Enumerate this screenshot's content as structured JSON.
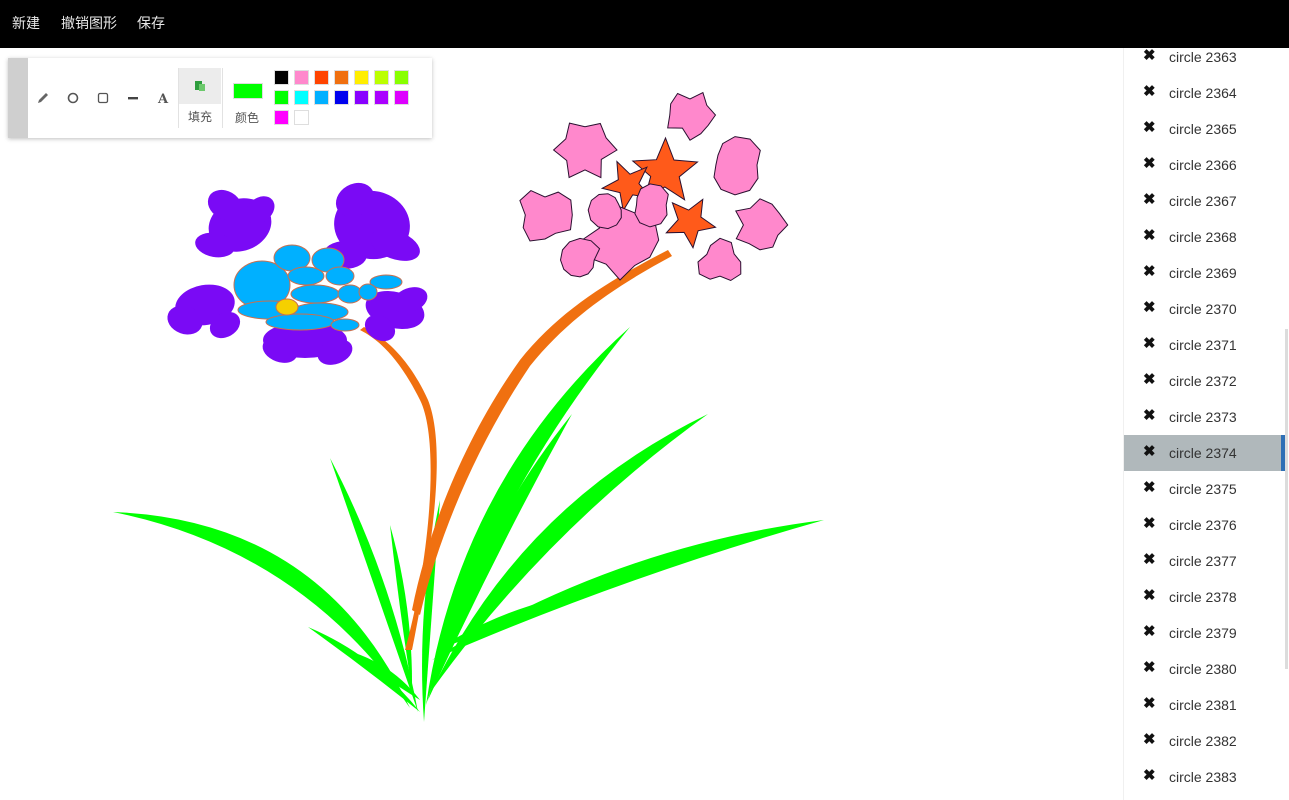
{
  "menu": {
    "new": "新建",
    "undo": "撤销图形",
    "save": "保存"
  },
  "toolbar": {
    "tools": [
      {
        "name": "pencil-tool",
        "icon": "pencil-icon"
      },
      {
        "name": "circle-tool",
        "icon": "circle-icon"
      },
      {
        "name": "rect-tool",
        "icon": "square-icon"
      },
      {
        "name": "line-tool",
        "icon": "line-icon"
      },
      {
        "name": "text-tool",
        "icon": "text-a-icon"
      }
    ],
    "fill_label": "填充",
    "color_label": "颜色",
    "current_color": "#00ff00",
    "palette": [
      "#000000",
      "#ff88cc",
      "#ff4400",
      "#f07010",
      "#ffee00",
      "#bbff00",
      "#88ff00",
      "#00ff00",
      "#00ffff",
      "#00b0ff",
      "#0000ee",
      "#8800ff",
      "#aa00ff",
      "#dd00ff",
      "#ff00ff",
      "#ffffff"
    ]
  },
  "shapes_list": {
    "selected_index": 11,
    "items": [
      "circle 2363",
      "circle 2364",
      "circle 2365",
      "circle 2366",
      "circle 2367",
      "circle 2368",
      "circle 2369",
      "circle 2370",
      "circle 2371",
      "circle 2372",
      "circle 2373",
      "circle 2374",
      "circle 2375",
      "circle 2376",
      "circle 2377",
      "circle 2378",
      "circle 2379",
      "circle 2380",
      "circle 2381",
      "circle 2382",
      "circle 2383"
    ]
  },
  "drawing_colors": {
    "leaf": "#00ff00",
    "stem": "#f07010",
    "purple_petal": "#7a0af5",
    "blue_center": "#00b0ff",
    "yellow_dot": "#f5d000",
    "pink_petal": "#ff88cc",
    "orange_star": "#ff5a1a"
  }
}
